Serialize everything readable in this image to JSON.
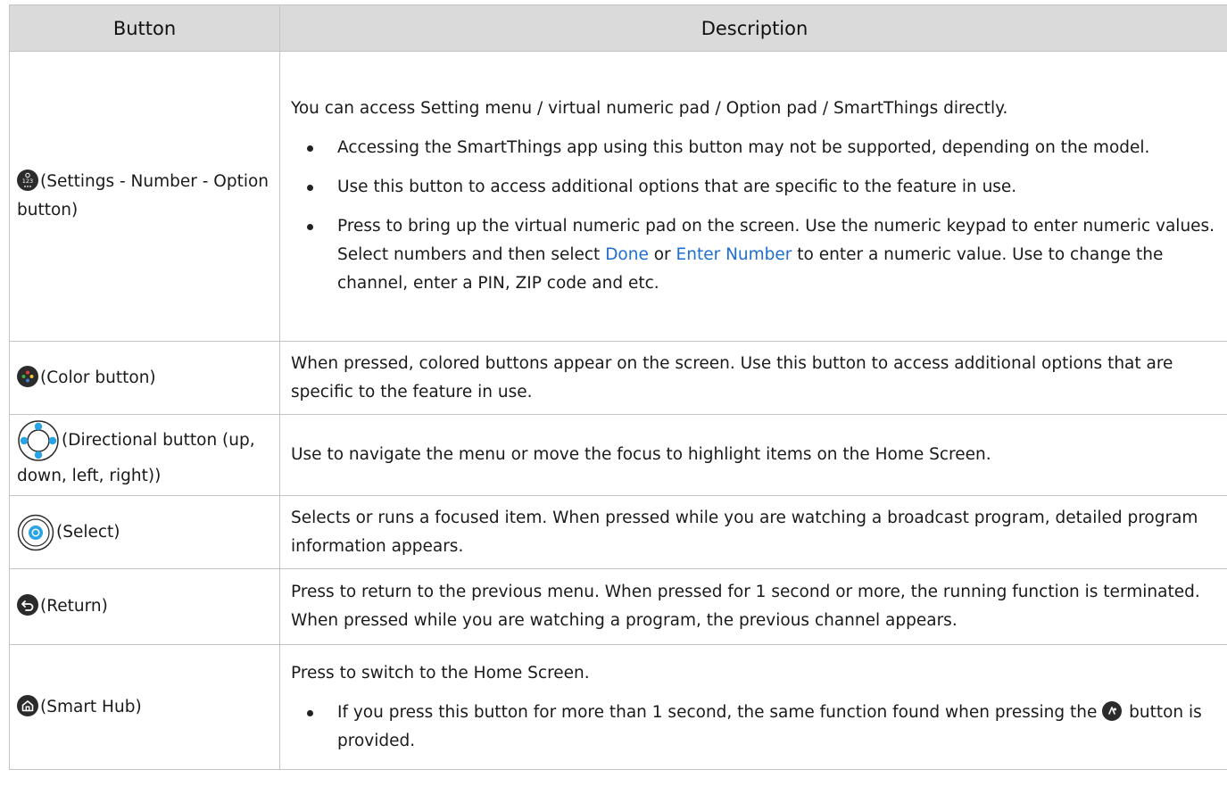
{
  "headers": {
    "button": "Button",
    "description": "Description"
  },
  "rows": {
    "settings": {
      "icon": "settings-number-option-icon",
      "label": "(Settings - Number - Option button)",
      "intro": "You can access Setting menu / virtual numeric pad / Option pad / SmartThings directly.",
      "bullet1": "Accessing the SmartThings app using this button may not be supported, depending on the model.",
      "bullet2": "Use this button to access additional options that are specific to the feature in use.",
      "bullet3_a": "Press to bring up the virtual numeric pad on the screen. Use the numeric keypad to enter numeric values. Select numbers and then select ",
      "bullet3_done": "Done",
      "bullet3_or": " or ",
      "bullet3_enter": "Enter Number",
      "bullet3_b": " to enter a numeric value. Use to change the channel, enter a PIN, ZIP code and etc."
    },
    "color": {
      "icon": "color-button-icon",
      "label": "(Color button)",
      "desc": "When pressed, colored buttons appear on the screen. Use this button to access additional options that are specific to the feature in use."
    },
    "directional": {
      "icon": "directional-pad-icon",
      "label": "(Directional button (up, down, left, right))",
      "desc": "Use to navigate the menu or move the focus to highlight items on the Home Screen."
    },
    "select": {
      "icon": "select-button-icon",
      "label": "(Select)",
      "desc": "Selects or runs a focused item. When pressed while you are watching a broadcast program, detailed program information appears."
    },
    "return": {
      "icon": "return-icon",
      "label": "(Return)",
      "desc": "Press to return to the previous menu. When pressed for 1 second or more, the running function is terminated. When pressed while you are watching a program, the previous channel appears."
    },
    "smarthub": {
      "icon": "home-icon",
      "label": "(Smart Hub)",
      "intro": "Press to switch to the Home Screen.",
      "bullet_a": "If you press this button for more than 1 second, the same function found when pressing the ",
      "bullet_icon": "accessibility-shortcut-icon",
      "bullet_b": " button is provided."
    }
  },
  "colors": {
    "header_bg": "#dadada",
    "border": "#c4c4c4",
    "ui_text": "#1e6fd0",
    "icon_dark": "#2b2b2b"
  }
}
